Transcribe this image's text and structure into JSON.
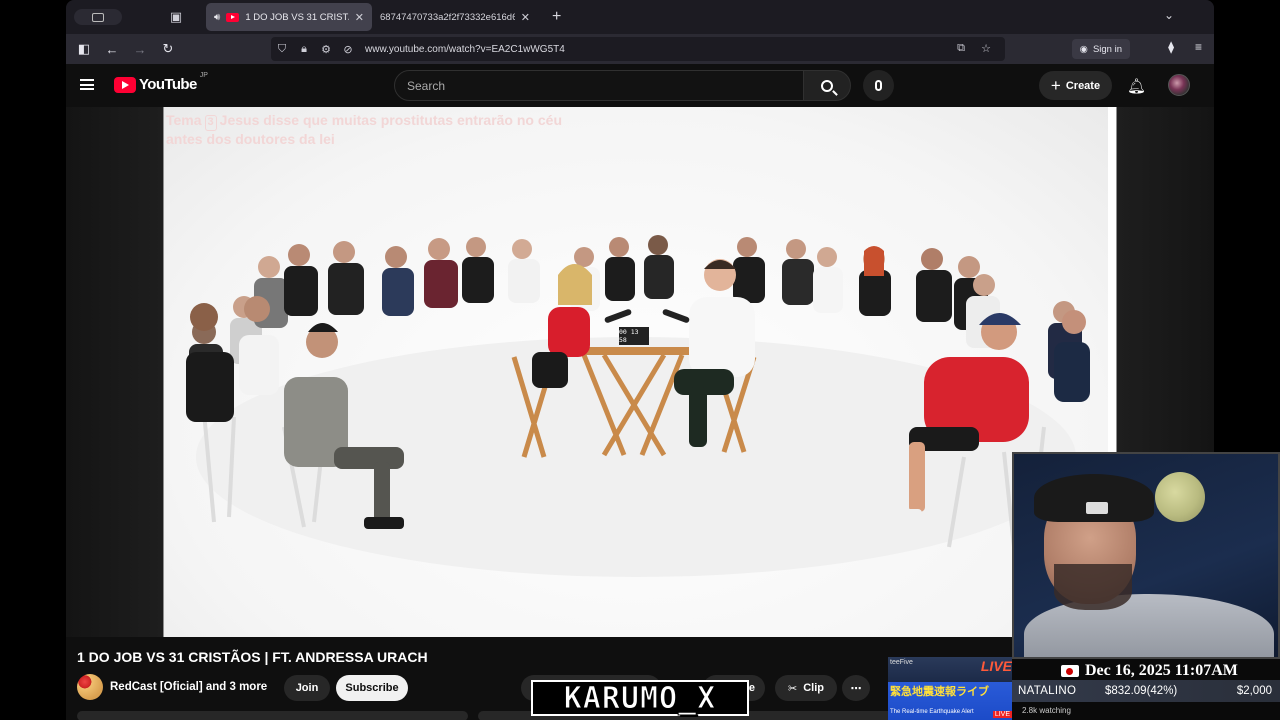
{
  "browser": {
    "tabs": [
      {
        "label": "1 DO JOB VS 31 CRISTÃOS |",
        "active": true,
        "icon": "youtube-favicon"
      },
      {
        "label": "68747470733a2f2f73332e616d617",
        "active": false
      }
    ],
    "url": "www.youtube.com/watch?v=EA2C1wWG5T4",
    "signin_label": "Sign in"
  },
  "youtube": {
    "logo_text": "YouTube",
    "country_code": "JP",
    "search_placeholder": "Search",
    "create_label": "Create"
  },
  "video": {
    "overlay_prefix": "Tema",
    "overlay_number": "3",
    "overlay_text_line1": "Jesus disse que muitas prostitutas entrarão no céu",
    "overlay_text_line2": "antes dos doutores da lei",
    "timer_display": "00 13 58",
    "title": "1 DO JOB VS 31 CRISTÃOS | FT. ANDRESSA URACH"
  },
  "channel": {
    "name": "RedCast [Oficial] and 3 more",
    "join_label": "Join",
    "subscribe_label": "Subscribe"
  },
  "actions": {
    "share_label": "re",
    "clip_label": "Clip",
    "more_label": "⋯"
  },
  "stream_overlay": {
    "logo_text": "KARUMO_X",
    "earthquake_banner": {
      "feeder": "teeFive",
      "live": "LIVE",
      "japanese": "緊急地震速報ライブ",
      "subtitle": "The Real-time Earthquake Alert",
      "live_tag": "LIVE"
    },
    "date": "Dec 16, 2025 11:07AM",
    "donor_name": "NATALINO",
    "amount": "$832.09(42%)",
    "goal": "$2,000",
    "watching": "2.8k watching"
  },
  "colors": {
    "yt_red": "#ff0033",
    "page_bg": "#0f0f0f",
    "chrome_bg": "#2b2a33"
  }
}
